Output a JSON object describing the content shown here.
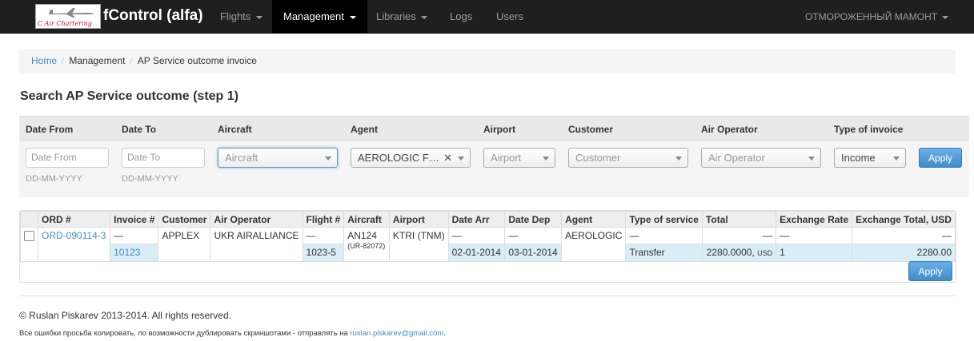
{
  "navbar": {
    "logo_text": "C Air Chartering",
    "brand": "fControl (alfa)",
    "items": [
      {
        "label": "Flights",
        "dropdown": true
      },
      {
        "label": "Management",
        "dropdown": true,
        "active": true
      },
      {
        "label": "Libraries",
        "dropdown": true
      },
      {
        "label": "Logs",
        "dropdown": false
      },
      {
        "label": "Users",
        "dropdown": false
      }
    ],
    "user": "ОТМОРОЖЕННЫЙ МАМОНТ"
  },
  "breadcrumb": [
    "Home",
    "Management",
    "AP Service outcome invoice"
  ],
  "page_title": "Search AP Service outcome (step 1)",
  "filters": {
    "headers": [
      "Date From",
      "Date To",
      "Aircraft",
      "Agent",
      "Airport",
      "Customer",
      "Air Operator",
      "Type of invoice"
    ],
    "date_from_placeholder": "Date From",
    "date_to_placeholder": "Date To",
    "date_hint": "DD-MM-YYYY",
    "aircraft_placeholder": "Aircraft",
    "agent_value": "AEROLOGIC F…",
    "airport_placeholder": "Airport",
    "customer_placeholder": "Customer",
    "air_operator_placeholder": "Air Operator",
    "type_of_invoice_value": "Income",
    "apply_label": "Apply"
  },
  "table": {
    "columns": [
      "ORD #",
      "Invoice #",
      "Customer",
      "Air Operator",
      "Flight #",
      "Aircraft",
      "Airport",
      "Date Arr",
      "Date Dep",
      "Agent",
      "Type of service",
      "Total",
      "Exchange Rate",
      "Exchange Total, USD"
    ],
    "row": {
      "ord": "ORD-090114-3",
      "invoice_top": "—",
      "invoice": "10123",
      "customer": "APPLEX",
      "air_operator": "UKR AIRALLIANCE",
      "flight_top": "—",
      "flight": "1023-5",
      "aircraft": "AN124",
      "aircraft_reg": "(UR-82072)",
      "airport": "KTRI (TNM)",
      "date_arr_top": "—",
      "date_arr": "02-01-2014",
      "date_dep_top": "—",
      "date_dep": "03-01-2014",
      "agent": "AEROLOGIC",
      "service_top": "—",
      "service": "Transfer",
      "total_top": "—",
      "total": "2280.0000,",
      "total_currency": "USD",
      "rate_top": "—",
      "rate": "1",
      "exch_top": "—",
      "exch_total": "2280.00"
    },
    "apply_label": "Apply"
  },
  "footer": {
    "copyright": "© Ruslan Piskarev 2013-2014. All rights reserved.",
    "note": "Все ошибки просьба копировать, по возможности дублировать скриншотами - отправлять на",
    "email": "ruslan.piskarev@gmail.com",
    "note_end": "."
  }
}
